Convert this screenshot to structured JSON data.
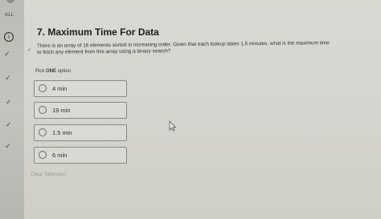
{
  "sidebar": {
    "all_label": "ALL",
    "current_marker": "i",
    "items": [
      {
        "state": "answered",
        "icon": "check-icon"
      },
      {
        "state": "answered",
        "icon": "check-icon"
      },
      {
        "state": "answered",
        "icon": "check-icon"
      },
      {
        "state": "answered",
        "icon": "check-icon"
      },
      {
        "state": "answered",
        "icon": "check-icon"
      }
    ]
  },
  "question": {
    "title": "7. Maximum Time For Data",
    "body": "There is an array of 16 elements sorted in increasing order. Given that each lookup takes 1.5 minutes, what is the maximum time to fetch any element from this array using a binary search?",
    "pick_prefix": "Pick",
    "pick_emphasis": "ONE",
    "pick_suffix": "option"
  },
  "options": [
    {
      "label": "4 min",
      "selected": false
    },
    {
      "label": "19 min",
      "selected": false
    },
    {
      "label": "1.5 min",
      "selected": false
    },
    {
      "label": "6 min",
      "selected": false
    }
  ],
  "actions": {
    "clear_label": "Clear Selection"
  }
}
